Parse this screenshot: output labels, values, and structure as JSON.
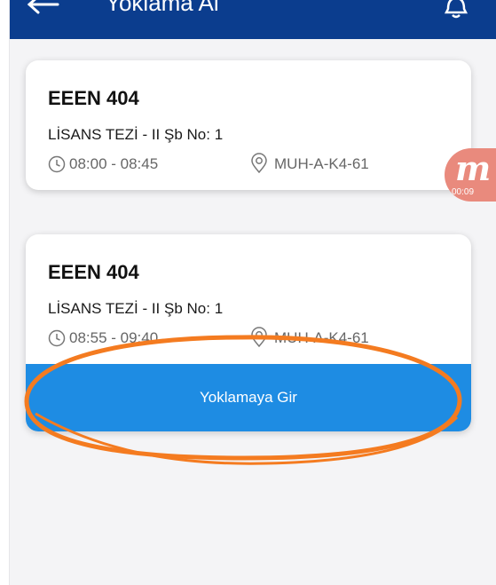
{
  "header": {
    "title": "Yoklama Al",
    "icons": {
      "back": "back-arrow-icon",
      "notifications": "bell-icon"
    }
  },
  "sessions": [
    {
      "course_code": "EEEN 404",
      "course_name": "LİSANS TEZİ - II Şb No: 1",
      "time": "08:00 - 08:45",
      "location": "MUH-A-K4-61"
    },
    {
      "course_code": "EEEN 404",
      "course_name": "LİSANS TEZİ - II Şb No: 1",
      "time": "08:55 - 09:40",
      "location": "MUH-A-K4-61",
      "action_label": "Yoklamaya Gir"
    }
  ],
  "recording_badge": {
    "logo": "m",
    "elapsed": "00:09"
  },
  "colors": {
    "header": "#0b3d8e",
    "action_button": "#1e8ce3",
    "annotation": "#f47b20",
    "recording_badge": "#e98a7d"
  }
}
